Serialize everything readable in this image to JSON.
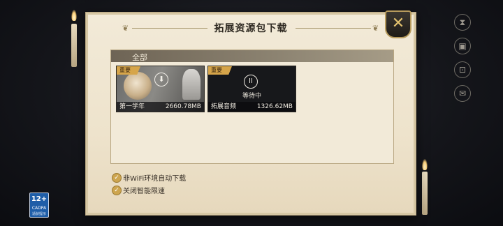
{
  "dialog": {
    "title": "拓展资源包下载",
    "close_glyph": "✕"
  },
  "tabs": {
    "all_label": "全部"
  },
  "packages": [
    {
      "tag": "重要",
      "name": "第一学年",
      "size": "2660.78MB",
      "status": "",
      "action_icon": "download-icon",
      "action_glyph": "⬇"
    },
    {
      "tag": "重要",
      "name": "拓展音频",
      "size": "1326.62MB",
      "status": "等待中",
      "action_icon": "pause-icon",
      "action_glyph": "II"
    }
  ],
  "options": [
    {
      "label": "非WiFi环境自动下载",
      "checked": true
    },
    {
      "label": "关闭智能限速",
      "checked": true
    }
  ],
  "age_rating": {
    "number": "12+",
    "org": "CADPA",
    "subtitle": "适龄提示"
  },
  "colors": {
    "accent_gold": "#cda54f",
    "tag_gold": "#d6a54a",
    "parchment": "#f2ead8"
  }
}
